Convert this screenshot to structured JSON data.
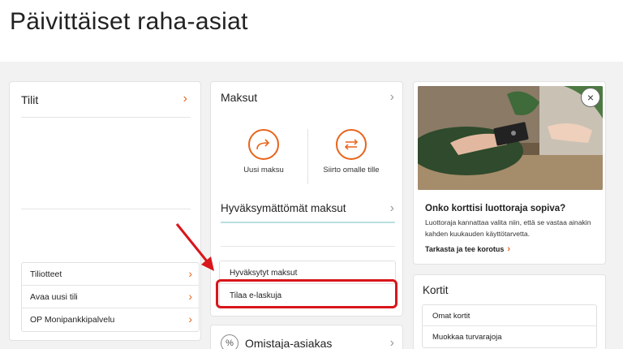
{
  "page": {
    "title": "Päivittäiset raha-asiat"
  },
  "tilit": {
    "title": "Tilit",
    "links": [
      {
        "label": "Tiliotteet"
      },
      {
        "label": "Avaa uusi tili"
      },
      {
        "label": "OP Monipankkipalvelu"
      }
    ]
  },
  "maksut": {
    "title": "Maksut",
    "actions": [
      {
        "label": "Uusi maksu"
      },
      {
        "label": "Siirto omalle tille"
      }
    ],
    "unapproved_title": "Hyväksymättömät maksut",
    "links": [
      {
        "label": "Hyväksytyt maksut"
      },
      {
        "label": "Tilaa e-laskuja"
      }
    ]
  },
  "omistaja": {
    "icon_text": "%",
    "label": "Omistaja-asiakas"
  },
  "promo": {
    "title": "Onko korttisi luottoraja sopiva?",
    "text": "Luottoraja kannattaa valita niin, että se vastaa ainakin kahden kuukauden käyttötarvetta.",
    "link": "Tarkasta ja tee korotus",
    "close_icon": "×"
  },
  "kortit": {
    "title": "Kortit",
    "links": [
      {
        "label": "Omat kortit"
      },
      {
        "label": "Muokkaa turvarajoja"
      }
    ]
  },
  "colors": {
    "accent": "#e8641b",
    "highlight": "#d8161b",
    "underline": "#b9dfe0"
  },
  "icons": {
    "chevron": "›",
    "new_payment": "arrow-forward-icon",
    "transfer": "transfer-arrows-icon"
  }
}
